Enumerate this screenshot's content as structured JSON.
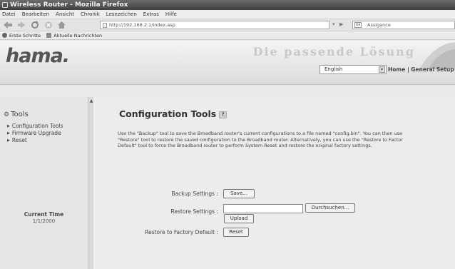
{
  "browser": {
    "window_title": "Wireless Router - Mozilla Firefox",
    "menu": [
      "Datei",
      "Bearbeiten",
      "Ansicht",
      "Chronik",
      "Lesezeichen",
      "Extras",
      "Hilfe"
    ],
    "url": "http://192.168.2.1/index.asp",
    "search_placeholder": "Assigance",
    "bookmarks": [
      "Erste Schritte",
      "Aktuelle Nachrichten"
    ]
  },
  "header": {
    "logo": "hama.",
    "tagline": "Die passende Lösung",
    "language": "English",
    "topnav": "Home | General Setup | S"
  },
  "sidebar": {
    "heading": "Tools",
    "items": [
      "Configuration Tools",
      "Firmware Upgrade",
      "Reset"
    ],
    "current_time_label": "Current Time",
    "current_time_value": "1/1/2000"
  },
  "main": {
    "title": "Configuration Tools",
    "help_icon": "?",
    "description": [
      "Use the \"Backup\" tool to save the Broadband router's current configurations to a file named \"config.bin\". You can then use",
      "\"Restore\" tool to restore the saved configuration to the Broadband router. Alternatively, you can use the \"Restore to Factor",
      "Default\" tool to force the Broadband router to perform System Reset and restore the original factory settings."
    ],
    "backup_label": "Backup Settings :",
    "backup_button": "Save...",
    "restore_label": "Restore Settings :",
    "browse_button": "Durchsuchen...",
    "upload_button": "Upload",
    "factory_label": "Restore to Factory Default :",
    "reset_button": "Reset"
  }
}
